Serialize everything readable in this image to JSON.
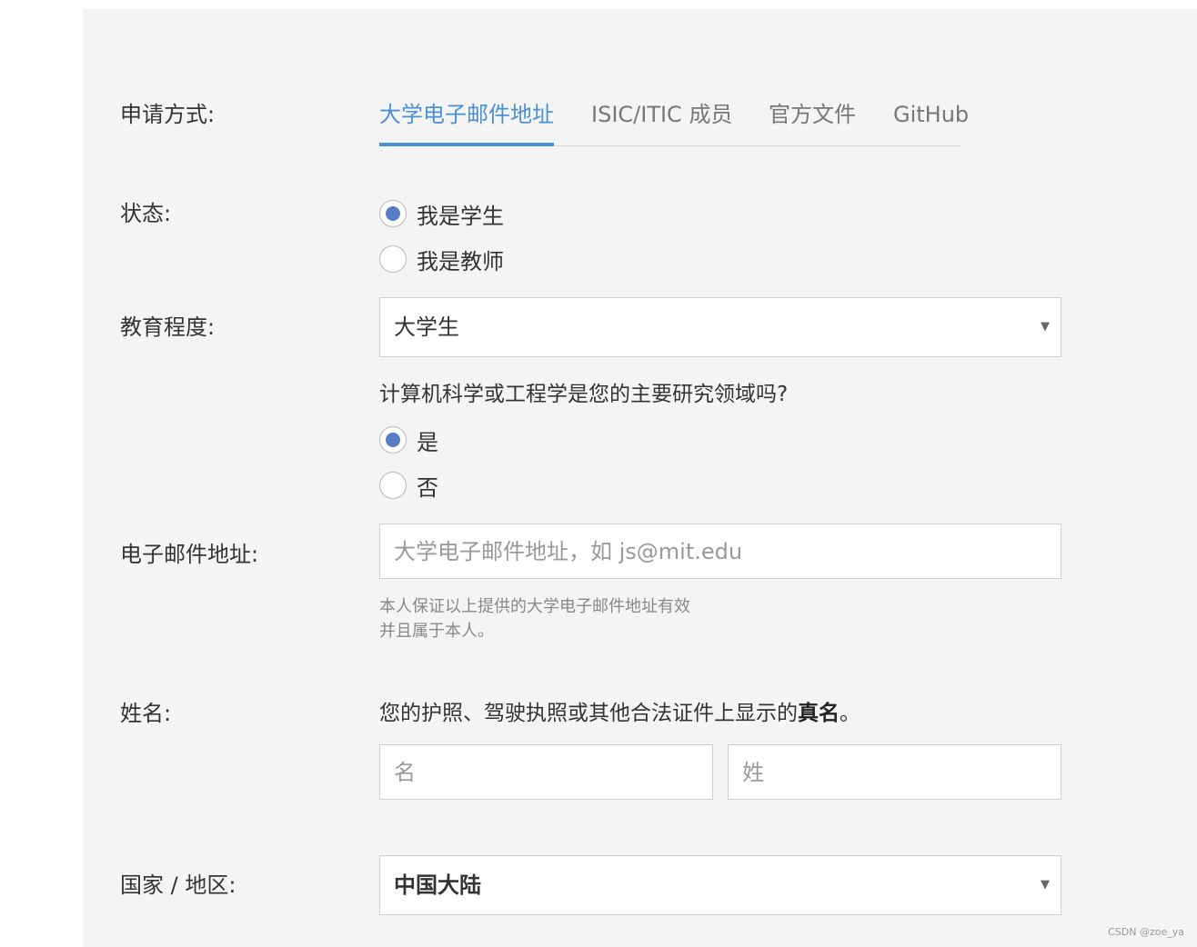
{
  "apply_method": {
    "label": "申请方式:",
    "tabs": [
      {
        "label": "大学电子邮件地址",
        "active": true
      },
      {
        "label": "ISIC/ITIC 成员",
        "active": false
      },
      {
        "label": "官方文件",
        "active": false
      },
      {
        "label": "GitHub",
        "active": false
      }
    ]
  },
  "status": {
    "label": "状态:",
    "options": [
      {
        "label": "我是学生",
        "checked": true
      },
      {
        "label": "我是教师",
        "checked": false
      }
    ]
  },
  "education": {
    "label": "教育程度:",
    "selected": "大学生",
    "question": "计算机科学或工程学是您的主要研究领域吗?",
    "options": [
      {
        "label": "是",
        "checked": true
      },
      {
        "label": "否",
        "checked": false
      }
    ]
  },
  "email": {
    "label": "电子邮件地址:",
    "placeholder": "大学电子邮件地址，如 js@mit.edu",
    "value": "",
    "hint_line1": "本人保证以上提供的大学电子邮件地址有效",
    "hint_line2": "并且属于本人。"
  },
  "name": {
    "label": "姓名:",
    "hint_prefix": "您的护照、驾驶执照或其他合法证件上显示的",
    "hint_bold": "真名",
    "hint_suffix": "。",
    "first_placeholder": "名",
    "last_placeholder": "姓"
  },
  "country": {
    "label": "国家 / 地区:",
    "selected": "中国大陆"
  },
  "watermark": "CSDN @zoe_ya",
  "colors": {
    "accent": "#4a90d9",
    "radio_fill": "#5a7cc6",
    "panel_bg": "#f4f4f4"
  }
}
